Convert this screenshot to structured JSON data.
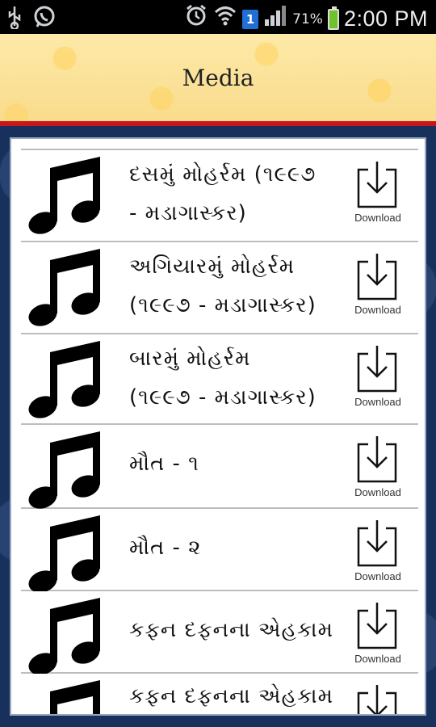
{
  "status_bar": {
    "time": "2:00 PM",
    "battery_percent": "71%",
    "notification_badge": "1",
    "battery_color": "#6ec22c"
  },
  "header": {
    "title": "Media",
    "accent_color": "#c8171c"
  },
  "items": [
    {
      "line1": "દસમું મોહર્રમ (૧૯૯૭",
      "line2": "- મડાગાસ્કર)",
      "download_label": "Download"
    },
    {
      "line1": "અગિયારમું મોહર્રમ",
      "line2": "(૧૯૯૭ - મડાગાસ્કર)",
      "download_label": "Download"
    },
    {
      "line1": "બારમું મોહર્રમ",
      "line2": "(૧૯૯૭ - મડાગાસ્કર)",
      "download_label": "Download"
    },
    {
      "line1": "મૌત - ૧",
      "line2": "",
      "download_label": "Download"
    },
    {
      "line1": "મૌત - ૨",
      "line2": "",
      "download_label": "Download"
    },
    {
      "line1": "કફન દફનના એહકામ",
      "line2": "",
      "download_label": "Download"
    },
    {
      "line1": "કફન દફનના એહકામ",
      "line2": "",
      "download_label": ""
    }
  ]
}
